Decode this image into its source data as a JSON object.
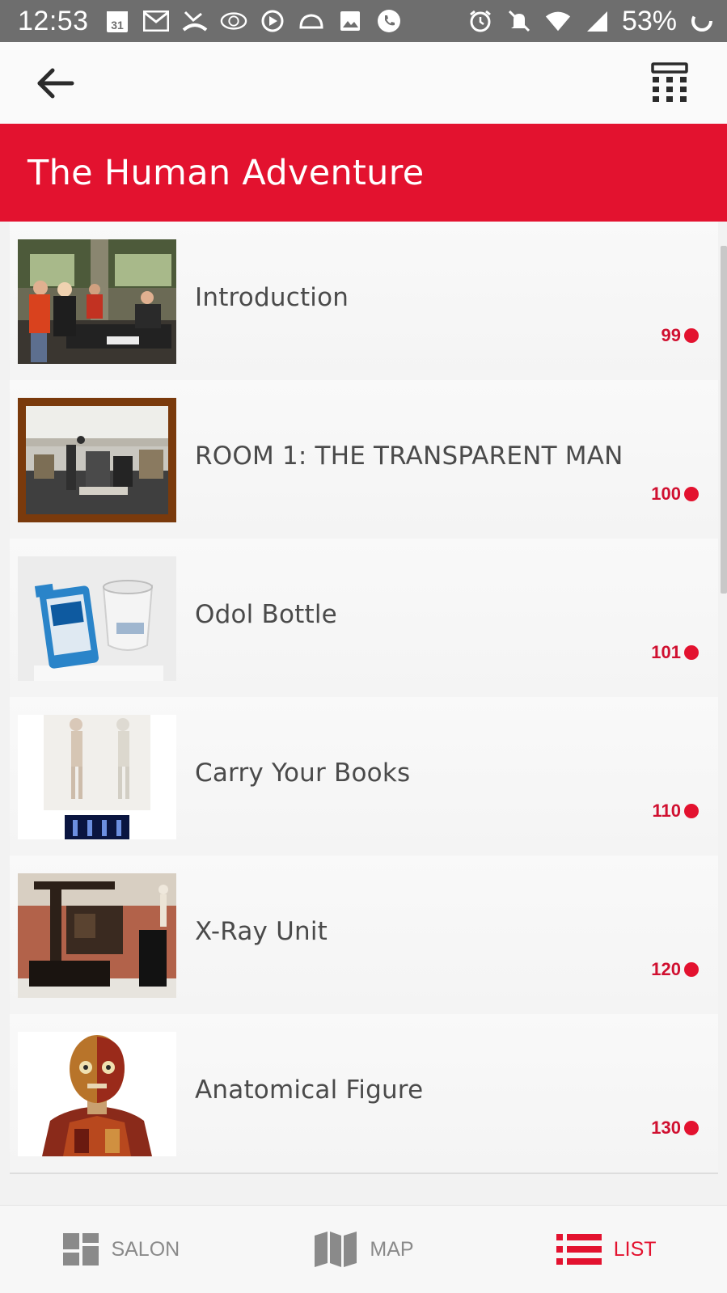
{
  "status_bar": {
    "time": "12:53",
    "calendar_day": "31",
    "battery": "53%",
    "icons_left": [
      "calendar-icon",
      "gmail-icon",
      "missed-call-icon",
      "wp-icon",
      "sync-icon",
      "cloud-icon",
      "image-icon",
      "phone-icon"
    ],
    "icons_right": [
      "alarm-icon",
      "mute-icon",
      "wifi-icon",
      "signal-icon",
      "battery-icon"
    ]
  },
  "app_bar": {
    "back_icon": "arrow-left-icon",
    "keypad_icon": "keypad-icon"
  },
  "header": {
    "title": "The Human Adventure",
    "accent_color": "#e3122f"
  },
  "items": [
    {
      "title": "Introduction",
      "number": "99",
      "thumb": "people-at-desk"
    },
    {
      "title": "ROOM 1: THE TRANSPARENT MAN",
      "number": "100",
      "thumb": "gallery-room"
    },
    {
      "title": "Odol Bottle",
      "number": "101",
      "thumb": "bottle-and-glass"
    },
    {
      "title": "Carry Your Books",
      "number": "110",
      "thumb": "figurines"
    },
    {
      "title": "X-Ray Unit",
      "number": "120",
      "thumb": "xray-machine"
    },
    {
      "title": "Anatomical Figure",
      "number": "130",
      "thumb": "anatomical-model"
    }
  ],
  "tabs": [
    {
      "label": "SALON",
      "icon": "grid-icon",
      "active": false
    },
    {
      "label": "MAP",
      "icon": "map-icon",
      "active": false
    },
    {
      "label": "LIST",
      "icon": "list-icon",
      "active": true
    }
  ]
}
